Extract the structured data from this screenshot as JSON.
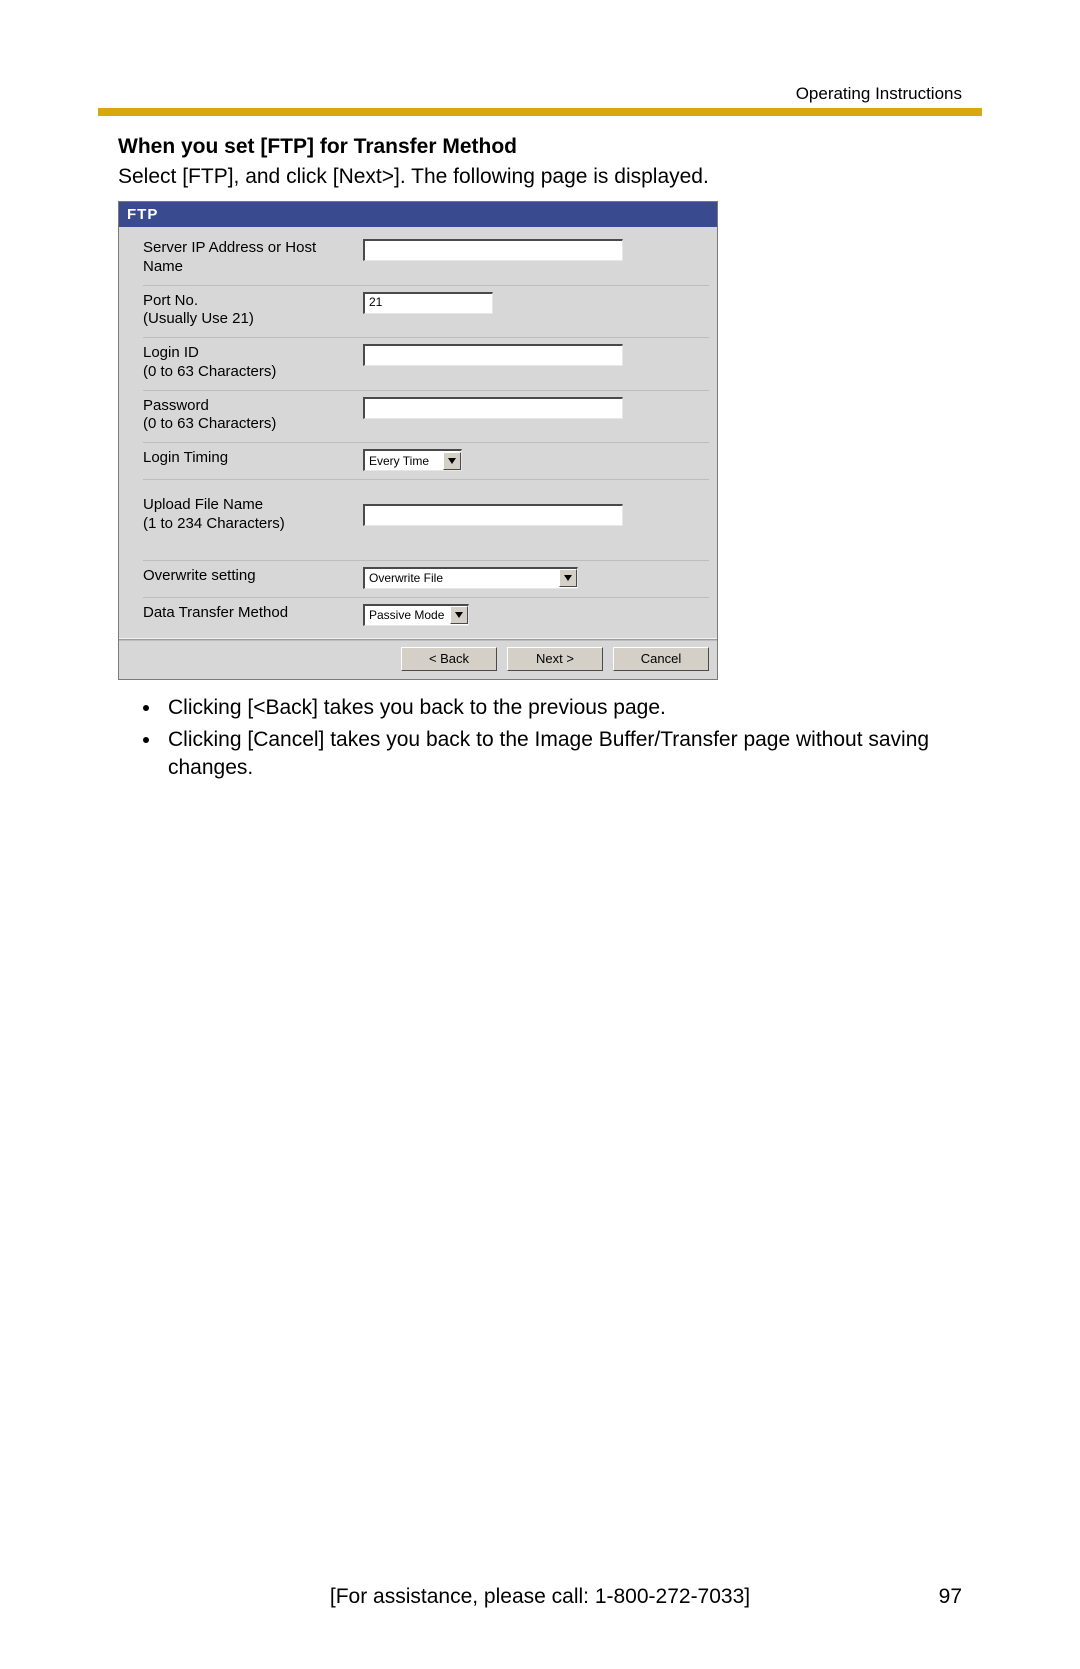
{
  "header": {
    "label": "Operating Instructions"
  },
  "section": {
    "title": "When you set [FTP] for Transfer Method",
    "intro": "Select [FTP], and click [Next>]. The following page is displayed."
  },
  "panel": {
    "title": "FTP",
    "fields": {
      "server": {
        "label1": "Server IP Address or Host",
        "label2": "Name",
        "value": ""
      },
      "port": {
        "label1": "Port No.",
        "label2": "(Usually Use 21)",
        "value": "21"
      },
      "login": {
        "label1": "Login ID",
        "label2": "(0 to 63 Characters)",
        "value": ""
      },
      "password": {
        "label1": "Password",
        "label2": "(0 to 63 Characters)",
        "value": ""
      },
      "timing": {
        "label": "Login Timing",
        "selected": "Every Time"
      },
      "filename": {
        "label1": "Upload File Name",
        "label2": "(1 to 234 Characters)",
        "value": ""
      },
      "overwrite": {
        "label": "Overwrite setting",
        "selected": "Overwrite File"
      },
      "method": {
        "label": "Data Transfer Method",
        "selected": "Passive Mode"
      }
    },
    "buttons": {
      "back": "< Back",
      "next": "Next >",
      "cancel": "Cancel"
    }
  },
  "bullets": [
    "Clicking [<Back] takes you back to the previous page.",
    "Clicking [Cancel] takes you back to the Image Buffer/Transfer page without saving changes."
  ],
  "footer": {
    "assist": "[For assistance, please call: 1-800-272-7033]",
    "page": "97"
  }
}
